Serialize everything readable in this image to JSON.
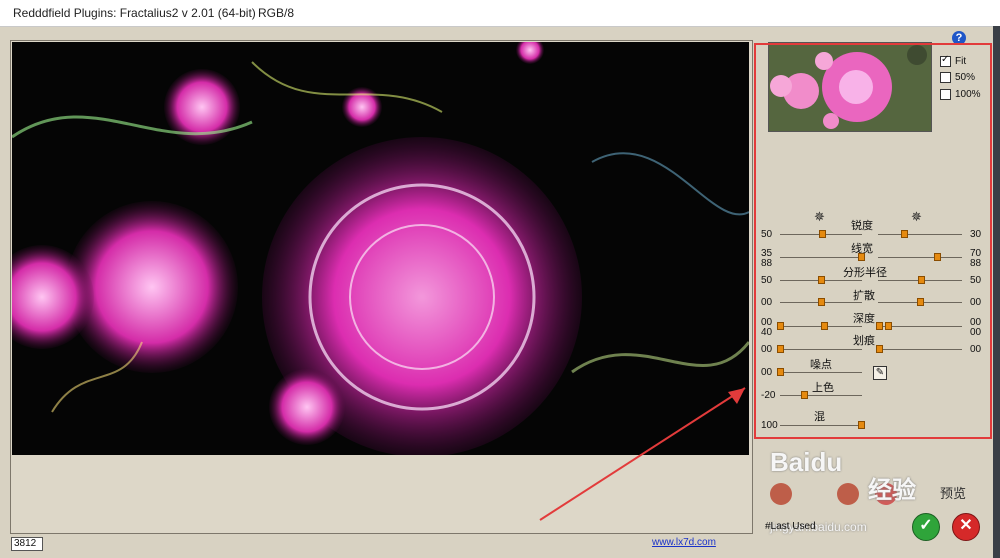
{
  "window": {
    "title": "Redddfield Plugins: Fractalius2 v 2.01 (64-bit)",
    "mode": "RGB/8"
  },
  "help": {
    "label": "?"
  },
  "zoom_options": [
    {
      "label": "Fit",
      "checked": true
    },
    {
      "label": "50%",
      "checked": false
    },
    {
      "label": "100%",
      "checked": false
    }
  ],
  "parameters": [
    {
      "name": "锐度",
      "left_value": "50",
      "right_value": "30",
      "left_level": 0.22,
      "right_level": 0.6
    },
    {
      "name": "线宽",
      "left_value": "35",
      "left_value2": "88",
      "right_value": "70",
      "right_value2": "88",
      "left_level": 0.22,
      "right_level": 0.82
    },
    {
      "name": "分形半径",
      "left_value": "50",
      "right_value": "50",
      "left_level": 0.22,
      "right_level": 0.72
    },
    {
      "name": "扩散",
      "left_value": "00",
      "right_value": "00",
      "left_level": 0.22,
      "right_level": 0.72
    },
    {
      "name": "深度",
      "left_value": "00",
      "left_value2": "40",
      "right_value": "00",
      "right_value2": "00",
      "left_level": 0.22,
      "right_level": 0.4
    },
    {
      "name": "划痕",
      "left_value": "00",
      "right_value": "00",
      "left_level": 0.0,
      "right_level": 0.0
    },
    {
      "name": "噪点",
      "left_value": "00",
      "left_level": 0.0
    },
    {
      "name": "上色",
      "left_value": "-20",
      "left_level": 0.2
    },
    {
      "name": "混",
      "left_value": "100",
      "left_level": 1.0
    }
  ],
  "status": {
    "value": "3812"
  },
  "link": {
    "text": "www.lx7d.com"
  },
  "preset": {
    "label": "#Last Used"
  },
  "buttons": {
    "ok": "✓",
    "cancel": "✕"
  },
  "watermark": {
    "brand": "Bai",
    "brand2": "du",
    "word": "经验",
    "url": "jingyan.baidu.com"
  },
  "bottom_label": "预览",
  "colors": {
    "accent": "#e58a10",
    "annotation": "#e23b3b",
    "ok": "#2fa43a",
    "cancel": "#d52929"
  }
}
